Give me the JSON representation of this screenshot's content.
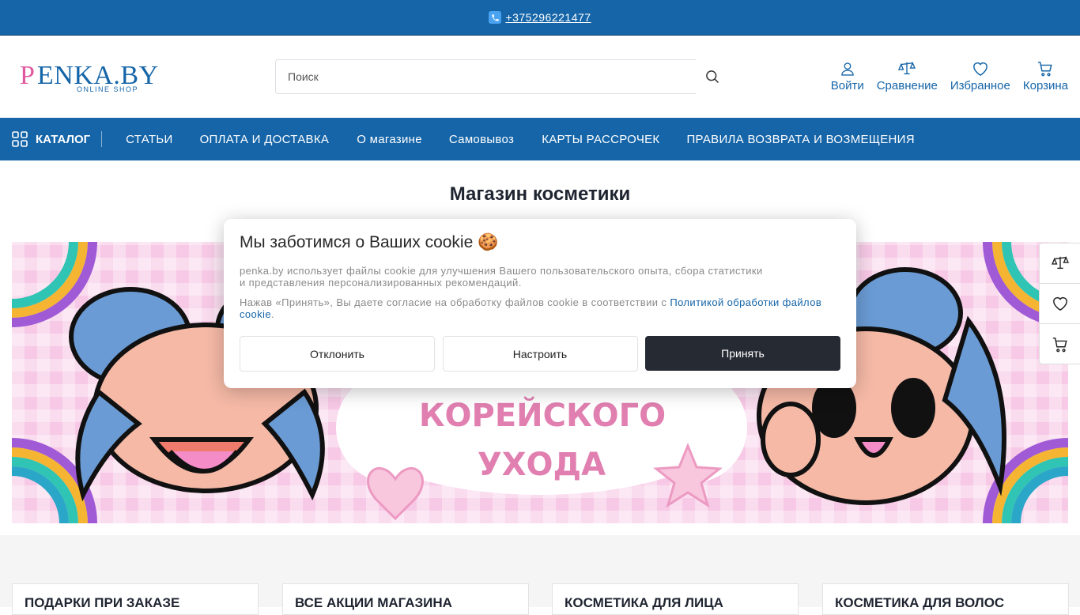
{
  "topbar": {
    "phone": "+375296221477"
  },
  "header": {
    "logo_text": "PENKA.BY",
    "logo_sub": "ONLINE SHOP",
    "search_placeholder": "Поиск",
    "actions": [
      {
        "label": "Войти",
        "icon": "user-icon"
      },
      {
        "label": "Сравнение",
        "icon": "scales-icon"
      },
      {
        "label": "Избранное",
        "icon": "heart-icon"
      },
      {
        "label": "Корзина",
        "icon": "cart-icon"
      }
    ]
  },
  "nav": {
    "catalog": "КАТАЛОГ",
    "items": [
      "СТАТЬИ",
      "ОПЛАТА И ДОСТАВКА",
      "О магазине",
      "Самовывоз",
      "КАРТЫ РАССРОЧЕК",
      "ПРАВИЛА ВОЗВРАТА И ВОЗМЕЩЕНИЯ"
    ]
  },
  "main": {
    "title": "Магазин косметики",
    "banner_line1": "КОРЕЙСКОГО",
    "banner_line2": "УХОДА"
  },
  "categories": [
    "ПОДАРКИ ПРИ ЗАКАЗЕ",
    "ВСЕ АКЦИИ МАГАЗИНА",
    "КОСМЕТИКА ДЛЯ ЛИЦА",
    "КОСМЕТИКА ДЛЯ ВОЛОС"
  ],
  "cookie": {
    "title": "Мы заботимся о Ваших cookie 🍪",
    "text1_line1": "penka.by использует файлы cookie для улучшения Вашего пользовательского опыта, сбора статистики",
    "text1_line2": "и представления персонализированных рекомендаций.",
    "text2": "Нажав «Принять», Вы даете согласие на обработку файлов cookie в соответствии с ",
    "link": "Политикой обработки файлов cookie",
    "text2_end": ".",
    "decline": "Отклонить",
    "configure": "Настроить",
    "accept": "Принять"
  },
  "colors": {
    "brand_blue": "#1565a8",
    "dark_button": "#262b33",
    "pink": "#e0589f"
  }
}
